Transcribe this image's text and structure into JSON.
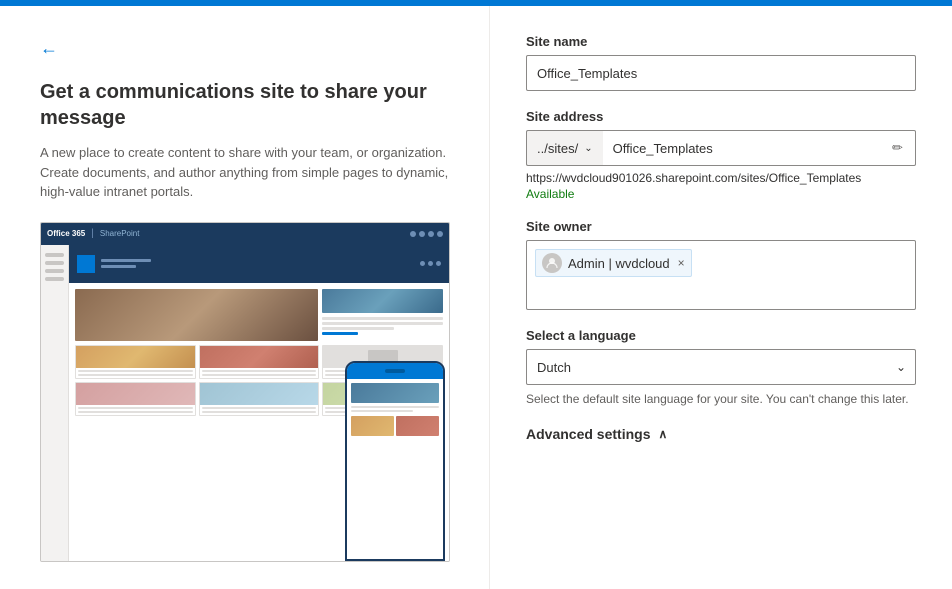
{
  "topbar": {
    "color": "#0078d4"
  },
  "left": {
    "back_button_label": "←",
    "heading": "Get a communications site to share your message",
    "description": "A new place to create content to share with your team, or organization. Create documents, and author anything from simple pages to dynamic, high-value intranet portals."
  },
  "right": {
    "site_name_label": "Site name",
    "site_name_value": "Office_Templates",
    "site_address_label": "Site address",
    "site_address_prefix": "../sites/",
    "site_address_chevron": "⌄",
    "site_address_value": "Office_Templates",
    "site_address_edit_icon": "✏",
    "site_url": "https://wvdcloud901026.sharepoint.com/sites/Office_Templates",
    "site_available": "Available",
    "site_owner_label": "Site owner",
    "owner_name": "Admin | wvdcloud",
    "owner_remove": "×",
    "language_label": "Select a language",
    "language_value": "Dutch",
    "language_chevron": "⌄",
    "language_note": "Select the default site language for your site. You can't change this later.",
    "advanced_settings_label": "Advanced settings",
    "advanced_settings_chevron": "∧"
  }
}
